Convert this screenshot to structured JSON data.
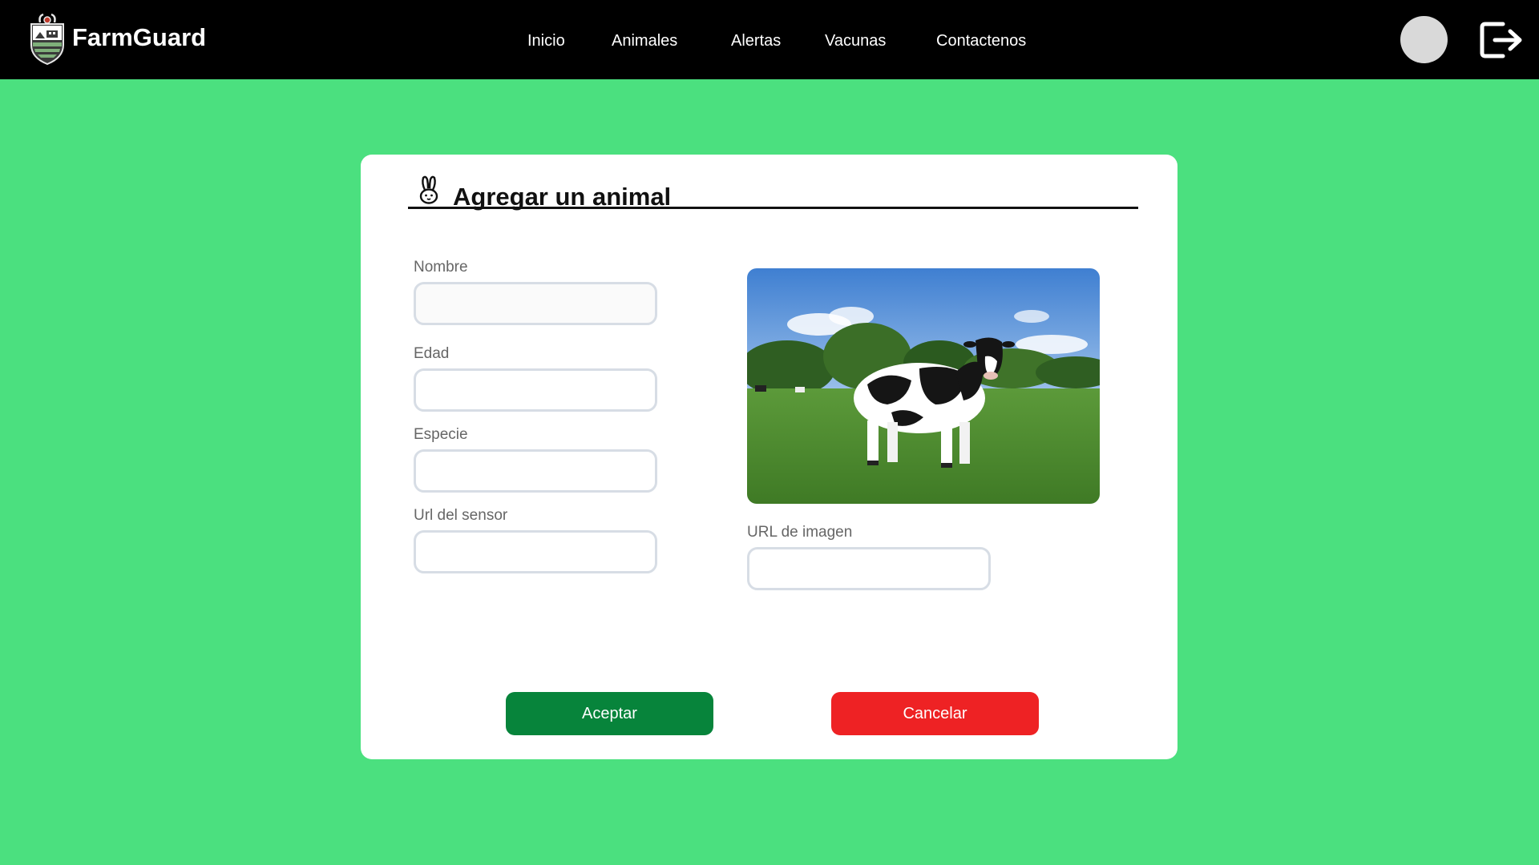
{
  "app": {
    "name": "FarmGuard"
  },
  "nav": {
    "items": [
      {
        "label": "Inicio"
      },
      {
        "label": "Animales"
      },
      {
        "label": "Alertas"
      },
      {
        "label": "Vacunas"
      },
      {
        "label": "Contactenos"
      }
    ]
  },
  "icons": {
    "logo": "shield-farm-logo",
    "avatar": "user-avatar",
    "logout": "logout-icon",
    "header": "rabbit-icon"
  },
  "form": {
    "title": "Agregar un animal",
    "fields": [
      {
        "label": "Nombre",
        "value": "",
        "placeholder": ""
      },
      {
        "label": "Edad",
        "value": "",
        "placeholder": ""
      },
      {
        "label": "Especie",
        "value": "",
        "placeholder": ""
      },
      {
        "label": "Url del sensor",
        "value": "",
        "placeholder": ""
      }
    ],
    "image_url": {
      "label": "URL de imagen",
      "value": "",
      "placeholder": ""
    },
    "accept_label": "Aceptar",
    "cancel_label": "Cancelar"
  },
  "colors": {
    "page_background": "#4be07f",
    "navbar": "#000000",
    "accept": "#07843b",
    "cancel": "#ee2224",
    "input_border": "#d7dde5"
  }
}
